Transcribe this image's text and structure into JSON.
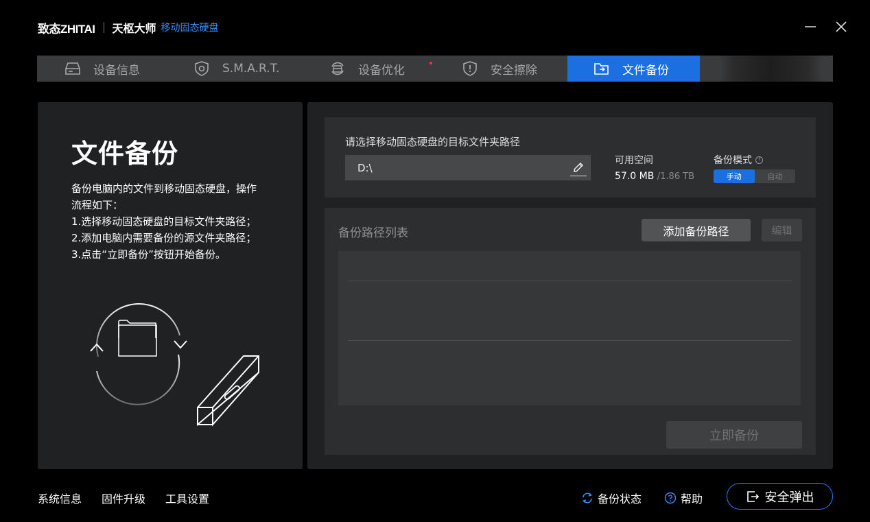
{
  "app": {
    "logo_text": "致态ZHITAI",
    "name": "天枢大师",
    "product": "移动固态硬盘"
  },
  "window": {
    "minimize_icon": "minimize-icon",
    "close_icon": "close-icon"
  },
  "tabs": [
    {
      "label": "设备信息",
      "icon": "drive-icon",
      "active": false
    },
    {
      "label": "S.M.A.R.T.",
      "icon": "shield-icon",
      "active": false
    },
    {
      "label": "设备优化",
      "icon": "optimize-icon",
      "active": false,
      "notification": true
    },
    {
      "label": "安全擦除",
      "icon": "alert-shield-icon",
      "active": false
    },
    {
      "label": "文件备份",
      "icon": "folder-icon",
      "active": true
    }
  ],
  "left": {
    "title": "文件备份",
    "desc_lines": [
      "备份电脑内的文件到移动固态硬盘，操作",
      "流程如下：",
      "1.选择移动固态硬盘的目标文件夹路径；",
      "2.添加电脑内需要备份的源文件夹路径；",
      "3.点击“立即备份”按钮开始备份。"
    ]
  },
  "target": {
    "label": "请选择移动固态硬盘的目标文件夹路径",
    "path_value": "D:\\",
    "space_label": "可用空间",
    "space_used": "57.0 MB",
    "space_total": "/1.86 TB",
    "mode_label": "备份模式",
    "mode_options": [
      "手动",
      "自动"
    ],
    "mode_selected": "手动"
  },
  "list": {
    "title": "备份路径列表",
    "add_button": "添加备份路径",
    "edit_button": "编辑",
    "backup_button": "立即备份"
  },
  "footer": {
    "links": [
      "系统信息",
      "固件升级",
      "工具设置"
    ],
    "backup_status": "备份状态",
    "help": "帮助",
    "eject": "安全弹出"
  },
  "colors": {
    "accent": "#1c6fe0",
    "background": "#000000",
    "panel": "#202122",
    "notification_dot": "#ff3030"
  }
}
